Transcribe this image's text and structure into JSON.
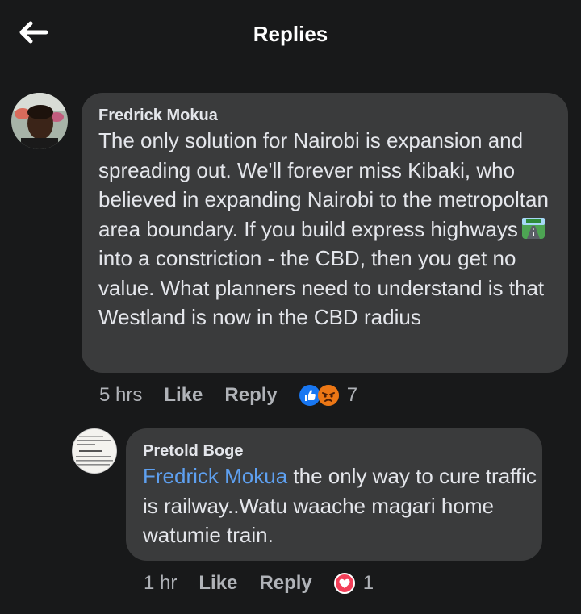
{
  "header": {
    "title": "Replies",
    "back_icon": "arrow-left-icon"
  },
  "comments": [
    {
      "author": "Fredrick Mokua",
      "text_before_emoji": "The only solution for Nairobi is expansion and spreading out. We'll forever miss Kibaki, who believed in expanding Nairobi to the metropoltan area boundary. If you build express highways",
      "emoji": "motorway-emoji",
      "text_after_emoji": "into a constriction - the CBD, then you get no value. What planners need to understand is that Westland is now in the CBD radius",
      "time": "5 hrs",
      "like_label": "Like",
      "reply_label": "Reply",
      "reactions": [
        "like-reaction-icon",
        "angry-reaction-icon"
      ],
      "reaction_count": "7"
    },
    {
      "author": "Pretold Boge",
      "mention": "Fredrick Mokua",
      "text": " the only way to cure traffic is railway..Watu waache magari home watumie train.",
      "time": "1 hr",
      "like_label": "Like",
      "reply_label": "Reply",
      "reactions": [
        "love-reaction-icon"
      ],
      "reaction_count": "1"
    }
  ],
  "colors": {
    "background": "#18191a",
    "bubble": "#3a3b3c",
    "mention": "#5ea0f0",
    "like": "#1877f2",
    "love": "#f33e58",
    "angry": "#e9710f"
  }
}
